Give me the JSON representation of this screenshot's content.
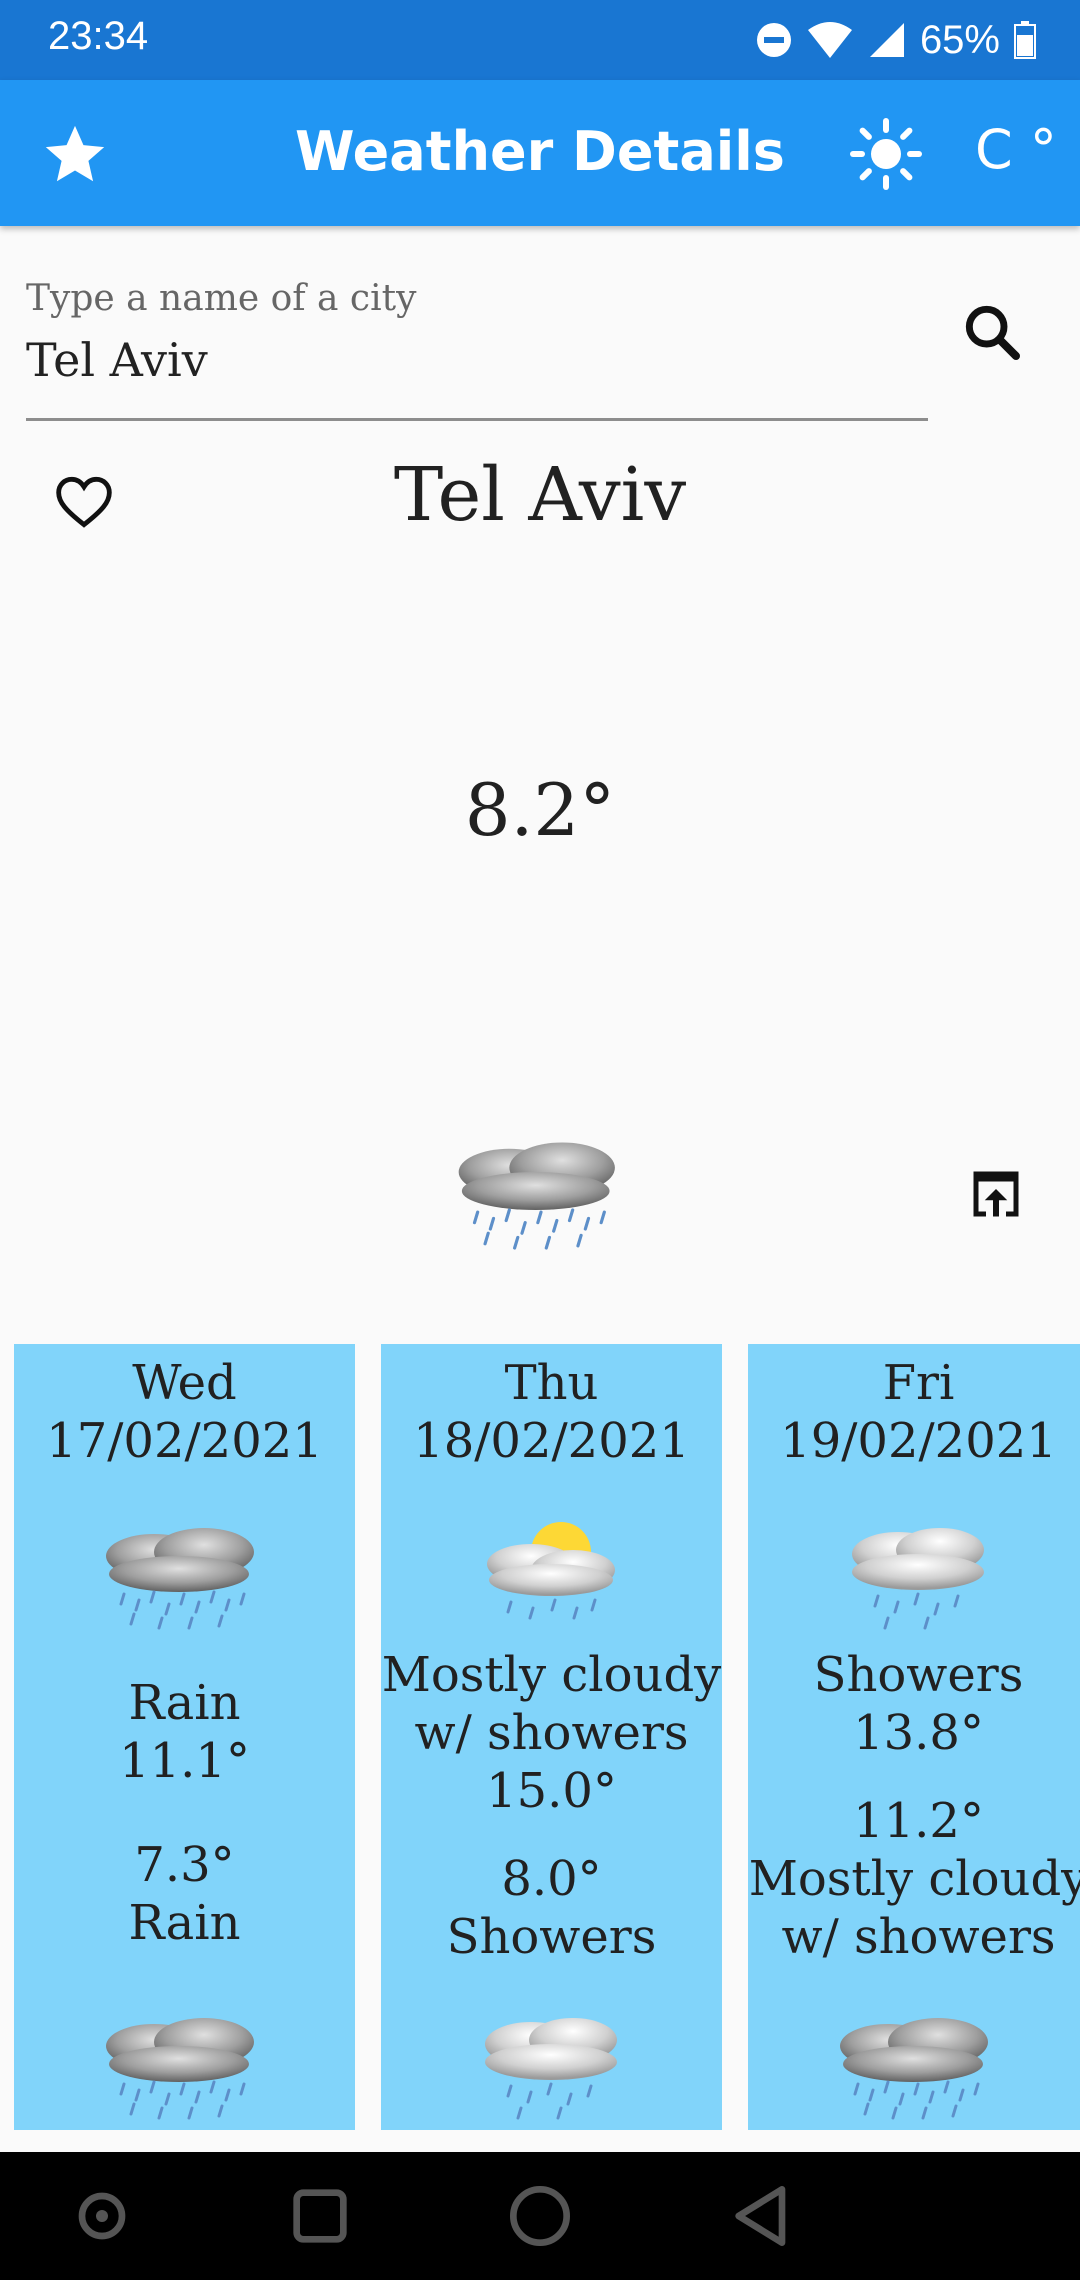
{
  "status_bar": {
    "time": "23:34",
    "battery": "65%"
  },
  "app_bar": {
    "title": "Weather Details",
    "unit_label": "C °"
  },
  "search": {
    "label": "Type a name of a city",
    "value": "Tel Aviv"
  },
  "current": {
    "city": "Tel Aviv",
    "temperature": "8.2°",
    "icon": "rain-cloud-icon"
  },
  "forecast": [
    {
      "day": "Wed",
      "date": "17/02/2021",
      "day_icon": "rain-cloud-icon",
      "day_condition": "Rain",
      "high": "11.1°",
      "low": "7.3°",
      "night_condition": "Rain",
      "night_icon": "rain-cloud-icon"
    },
    {
      "day": "Thu",
      "date": "18/02/2021",
      "day_icon": "sun-cloud-showers-icon",
      "day_condition_line1": "Mostly cloudy",
      "day_condition_line2": "w/ showers",
      "high": "15.0°",
      "low": "8.0°",
      "night_condition": "Showers",
      "night_icon": "showers-cloud-icon"
    },
    {
      "day": "Fri",
      "date": "19/02/2021",
      "day_icon": "showers-cloud-icon",
      "day_condition": "Showers",
      "high": "13.8°",
      "low": "11.2°",
      "night_condition_line1": "Mostly cloudy",
      "night_condition_line2": "w/ showers",
      "night_icon": "rain-cloud-icon"
    }
  ],
  "colors": {
    "status_bar": "#1976d2",
    "app_bar": "#2196f3",
    "forecast_card": "#81d4fa"
  }
}
